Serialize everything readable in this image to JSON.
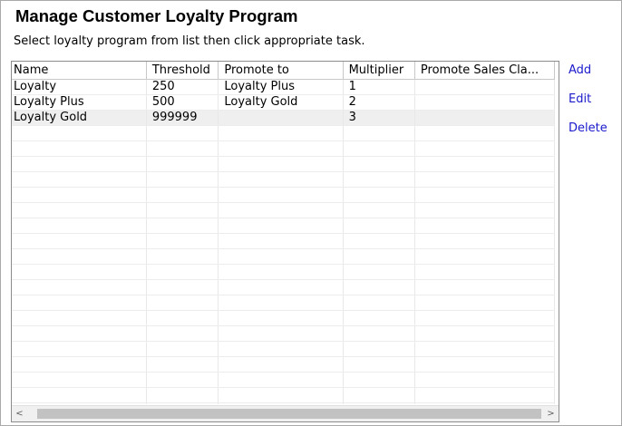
{
  "page": {
    "title": "Manage Customer Loyalty Program",
    "instructions": "Select loyalty program from list then click appropriate task."
  },
  "grid": {
    "columns": [
      "Name",
      "Threshold",
      "Promote to",
      "Multiplier",
      "Promote Sales Cla..."
    ],
    "rows": [
      [
        "Loyalty",
        "250",
        "Loyalty Plus",
        "1",
        ""
      ],
      [
        "Loyalty Plus",
        "500",
        "Loyalty Gold",
        "2",
        ""
      ],
      [
        "Loyalty Gold",
        "999999",
        "",
        "3",
        ""
      ]
    ],
    "selected_row": 2,
    "empty_rows": 19
  },
  "scrollbar": {
    "left_arrow": "<",
    "right_arrow": ">"
  },
  "actions": {
    "add_label": "Add",
    "edit_label": "Edit",
    "delete_label": "Delete"
  }
}
